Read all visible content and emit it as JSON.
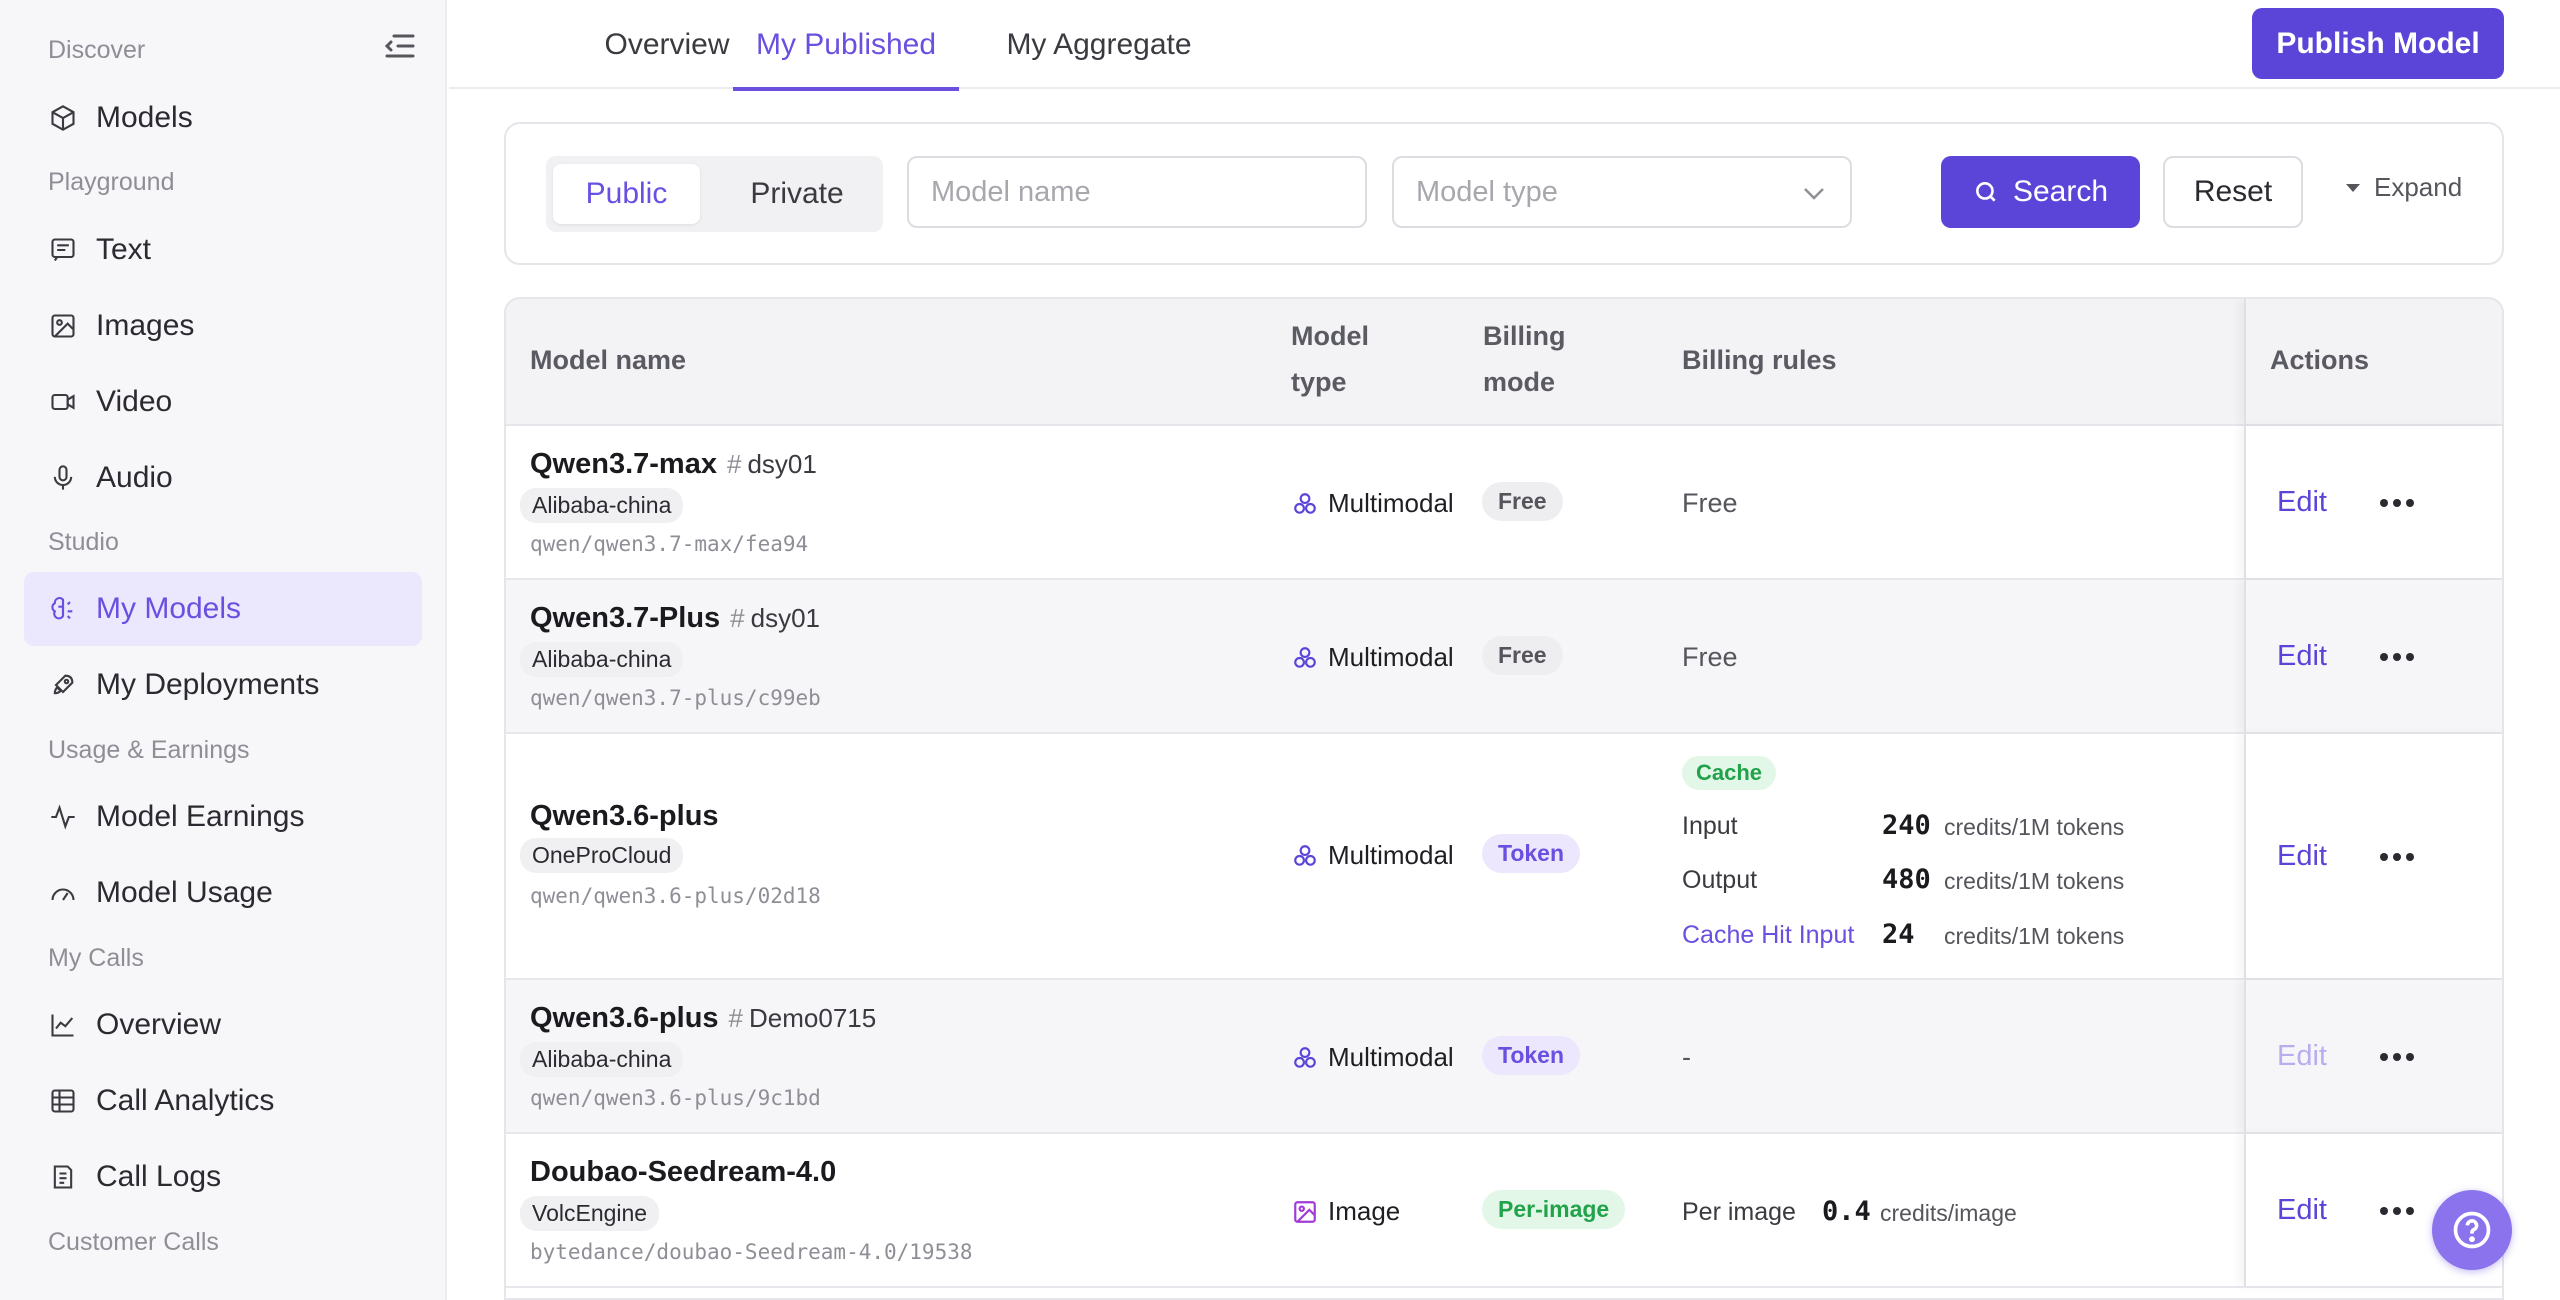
{
  "sidebar": {
    "sections": [
      "Discover",
      "Playground",
      "Studio",
      "Usage & Earnings",
      "My Calls",
      "Customer Calls"
    ],
    "items": [
      {
        "label": "Models",
        "icon": "cube-icon"
      },
      {
        "label": "Text",
        "icon": "message-icon"
      },
      {
        "label": "Images",
        "icon": "image-icon"
      },
      {
        "label": "Video",
        "icon": "video-icon"
      },
      {
        "label": "Audio",
        "icon": "mic-icon"
      },
      {
        "label": "My Models",
        "icon": "brain-icon",
        "active": true
      },
      {
        "label": "My Deployments",
        "icon": "rocket-icon"
      },
      {
        "label": "Model Earnings",
        "icon": "pulse-icon"
      },
      {
        "label": "Model Usage",
        "icon": "gauge-icon"
      },
      {
        "label": "Overview",
        "icon": "line-chart-icon"
      },
      {
        "label": "Call Analytics",
        "icon": "table-icon"
      },
      {
        "label": "Call Logs",
        "icon": "logs-icon"
      }
    ]
  },
  "tabs": [
    "Overview",
    "My Published",
    "My Aggregate"
  ],
  "active_tab": "My Published",
  "publish_label": "Publish Model",
  "filter": {
    "visibility": [
      "Public",
      "Private"
    ],
    "selected_visibility": "Public",
    "model_name_placeholder": "Model name",
    "model_type_placeholder": "Model type",
    "search_label": "Search",
    "reset_label": "Reset",
    "expand_label": "Expand"
  },
  "table": {
    "headers": {
      "name": "Model name",
      "type_l1": "Model",
      "type_l2": "type",
      "billing_l1": "Billing",
      "billing_l2": "mode",
      "rules": "Billing rules",
      "actions": "Actions"
    },
    "rows": [
      {
        "name": "Qwen3.7-max",
        "tag": "dsy01",
        "provider": "Alibaba-china",
        "path": "qwen/qwen3.7-max/fea94",
        "type": "Multimodal",
        "billing": "Free",
        "rule": "Free",
        "edit": "Edit"
      },
      {
        "name": "Qwen3.7-Plus",
        "tag": "dsy01",
        "provider": "Alibaba-china",
        "path": "qwen/qwen3.7-plus/c99eb",
        "type": "Multimodal",
        "billing": "Free",
        "rule": "Free",
        "edit": "Edit"
      },
      {
        "name": "Qwen3.6-plus",
        "tag": "",
        "provider": "OneProCloud",
        "path": "qwen/qwen3.6-plus/02d18",
        "type": "Multimodal",
        "billing": "Token",
        "cache_tag": "Cache",
        "rules": [
          {
            "label": "Input",
            "value": "240",
            "unit": "credits/1M tokens"
          },
          {
            "label": "Output",
            "value": "480",
            "unit": "credits/1M tokens"
          },
          {
            "label": "Cache Hit Input",
            "value": "24",
            "unit": "credits/1M tokens"
          }
        ],
        "edit": "Edit"
      },
      {
        "name": "Qwen3.6-plus",
        "tag": "Demo0715",
        "provider": "Alibaba-china",
        "path": "qwen/qwen3.6-plus/9c1bd",
        "type": "Multimodal",
        "billing": "Token",
        "rule": "-",
        "edit": "Edit"
      },
      {
        "name": "Doubao-Seedream-4.0",
        "tag": "",
        "provider": "VolcEngine",
        "path": "bytedance/doubao-Seedream-4.0/19538",
        "type": "Image",
        "billing": "Per-image",
        "per_image": {
          "label": "Per image",
          "value": "0.4",
          "unit": "credits/image"
        },
        "edit": "Edit"
      }
    ]
  },
  "colors": {
    "accent": "#5b45d9",
    "accent_light": "#ebe7fd",
    "green": "#22a34a"
  }
}
